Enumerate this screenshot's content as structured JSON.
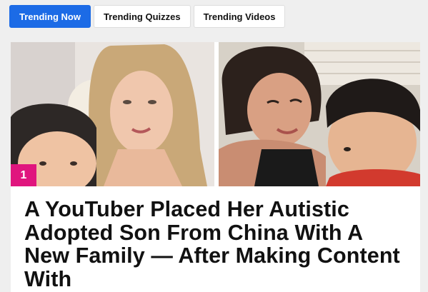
{
  "tabs": [
    {
      "label": "Trending Now",
      "active": true
    },
    {
      "label": "Trending Quizzes",
      "active": false
    },
    {
      "label": "Trending Videos",
      "active": false
    }
  ],
  "colors": {
    "accent": "#1c6be6",
    "rank_badge": "#e0157e",
    "background": "#efefef"
  },
  "article": {
    "rank": "1",
    "headline": "A YouTuber Placed Her Autistic Adopted Son From China With A New Family — After Making Content With"
  }
}
